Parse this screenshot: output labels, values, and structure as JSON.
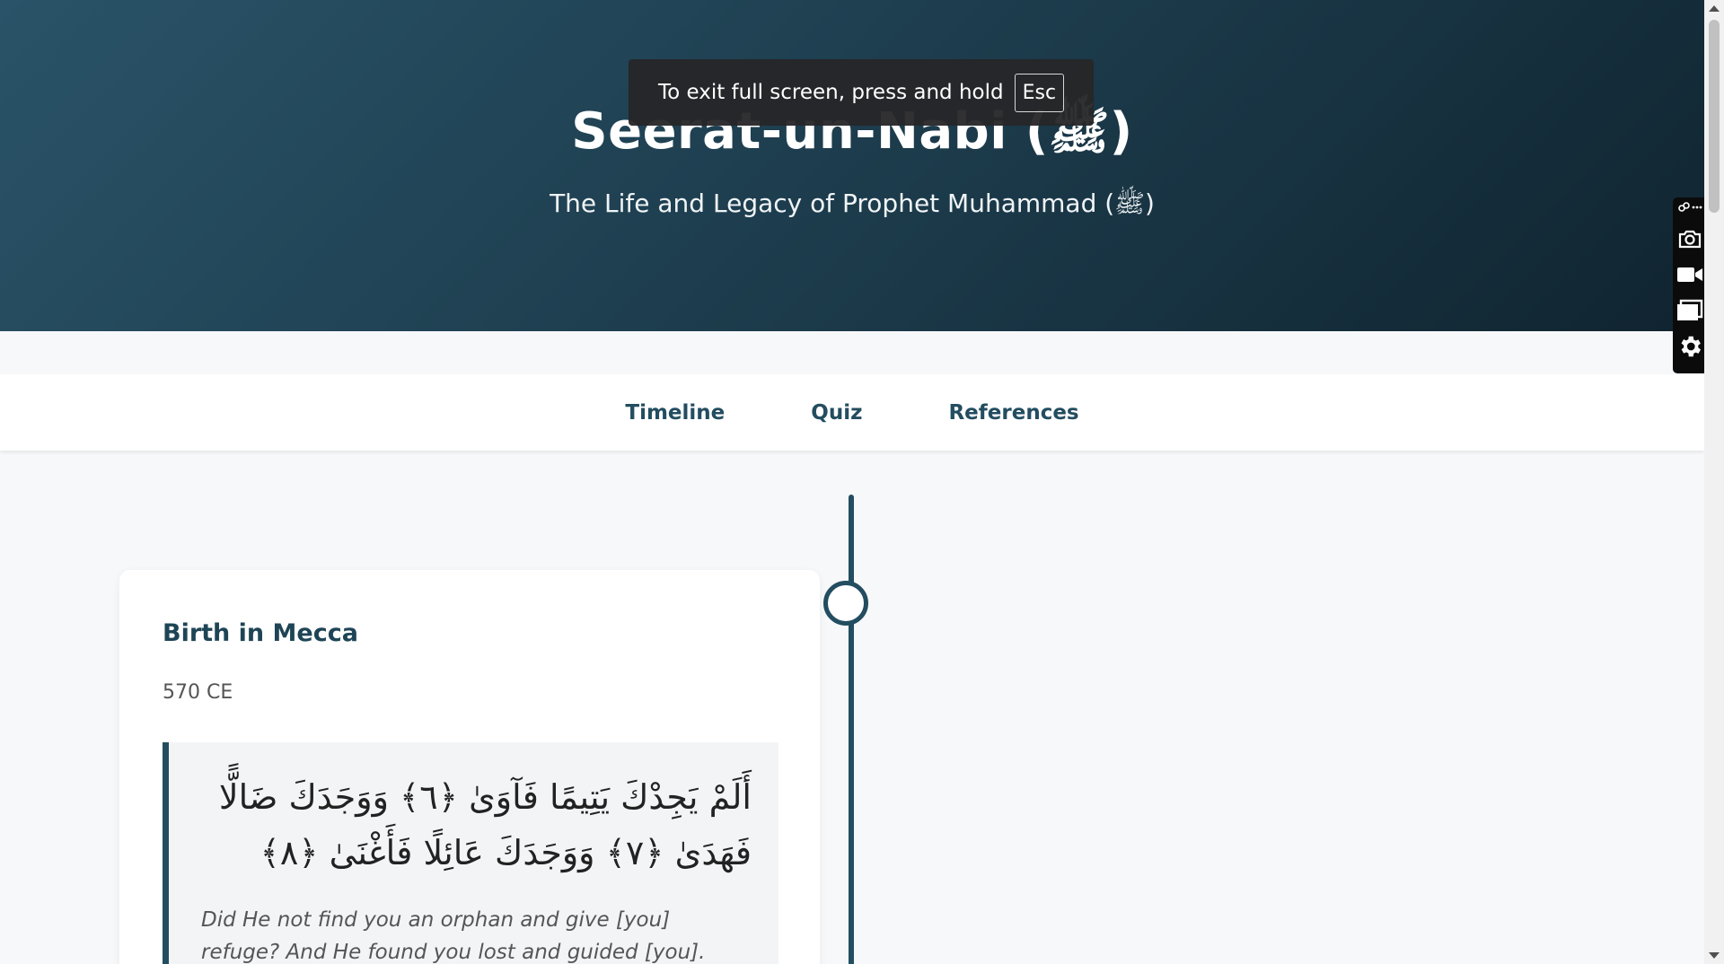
{
  "header": {
    "title": "Seerat-un-Nabi (ﷺ)",
    "subtitle": "The Life and Legacy of Prophet Muhammad (ﷺ)"
  },
  "fullscreen_notice": {
    "text": "To exit full screen, press and hold",
    "key": "Esc"
  },
  "nav": {
    "items": [
      {
        "label": "Timeline"
      },
      {
        "label": "Quiz"
      },
      {
        "label": "References"
      }
    ]
  },
  "timeline": {
    "events": [
      {
        "title": "Birth in Mecca",
        "date": "570 CE",
        "arabic": "أَلَمْ يَجِدْكَ يَتِيمًا فَآوَىٰ ﴿٦﴾ وَوَجَدَكَ ضَالًّا فَهَدَىٰ ﴿٧﴾ وَوَجَدَكَ عَائِلًا فَأَغْنَىٰ ﴿٨﴾",
        "translation": "Did He not find you an orphan and give [you] refuge? And He found you lost and guided [you]. And He found you"
      }
    ]
  },
  "side_toolbar": {
    "icons": [
      "link-icon",
      "more-icon",
      "camera-icon",
      "video-icon",
      "window-icon",
      "gear-icon"
    ]
  },
  "colors": {
    "hero_start": "#2a5368",
    "hero_end": "#102430",
    "accent": "#234d60",
    "page_bg": "#f7f8fa"
  }
}
